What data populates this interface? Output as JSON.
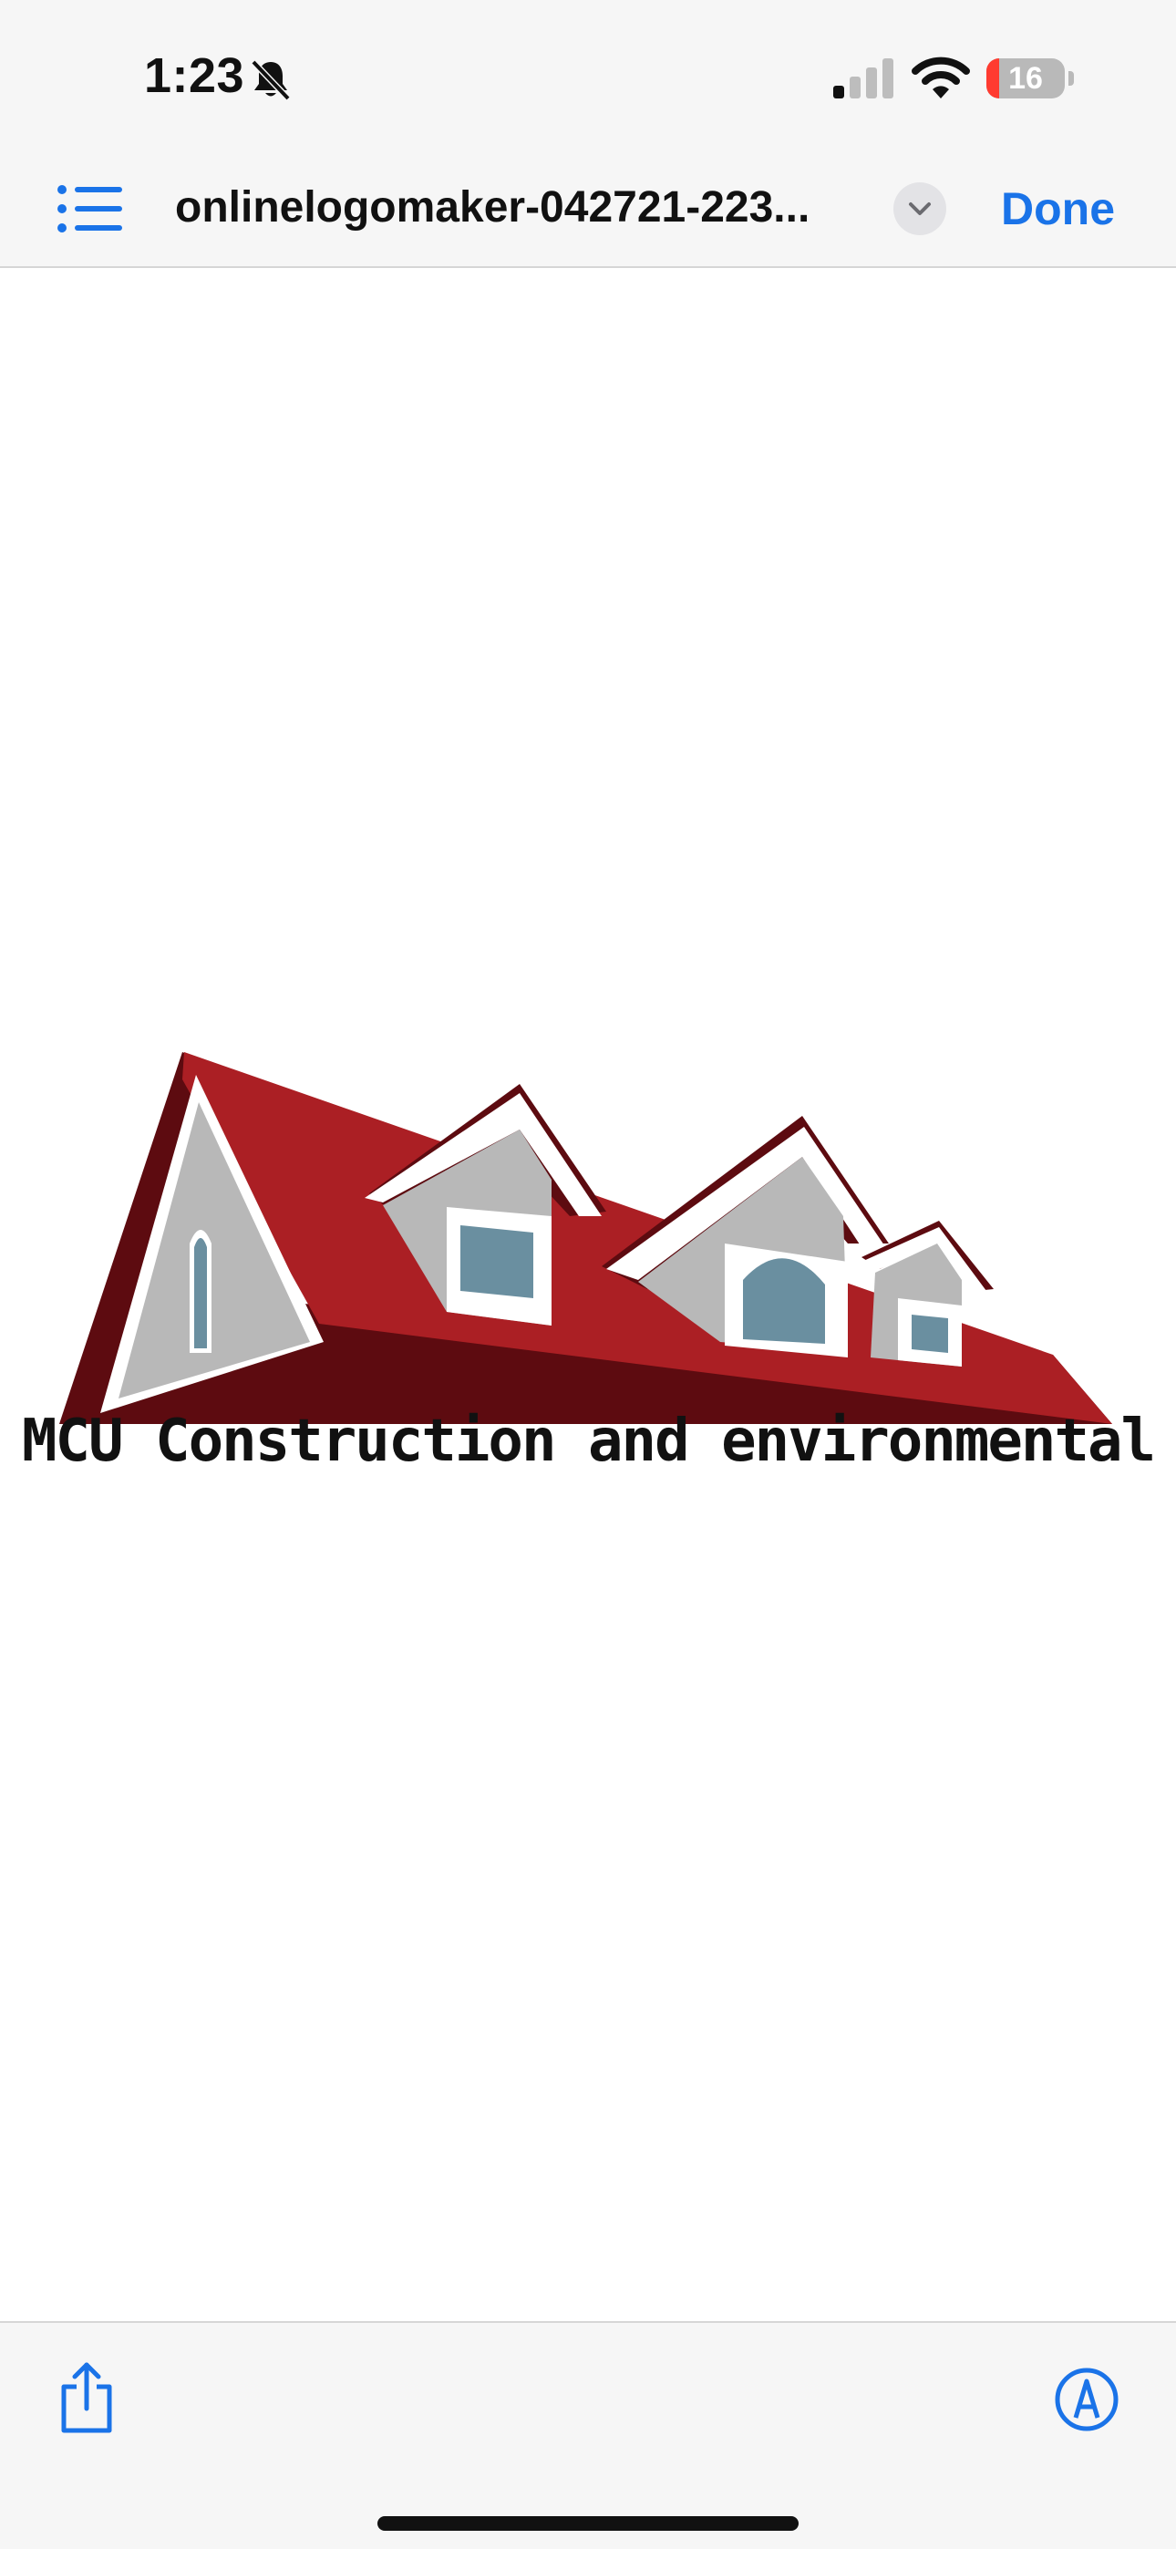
{
  "status_bar": {
    "time": "1:23",
    "battery_level": "16",
    "battery_fraction": 0.16,
    "icons": [
      "bell-slash-icon",
      "cellular-signal-icon",
      "wifi-icon",
      "battery-icon"
    ]
  },
  "nav": {
    "title": "onlinelogomaker-042721-223...",
    "done_label": "Done",
    "icons": [
      "list-icon",
      "chevron-down-icon"
    ]
  },
  "document": {
    "logo_text": "MCU Construction and environmental"
  },
  "toolbar": {
    "icons": [
      "share-icon",
      "markup-icon"
    ]
  },
  "colors": {
    "accent": "#1a73e8",
    "roof_red": "#ab1f24",
    "roof_dark": "#5d0b10",
    "wall_gray": "#b8b8b8",
    "window_blue": "#6a8fa0",
    "battery_low": "#ff3b30"
  }
}
